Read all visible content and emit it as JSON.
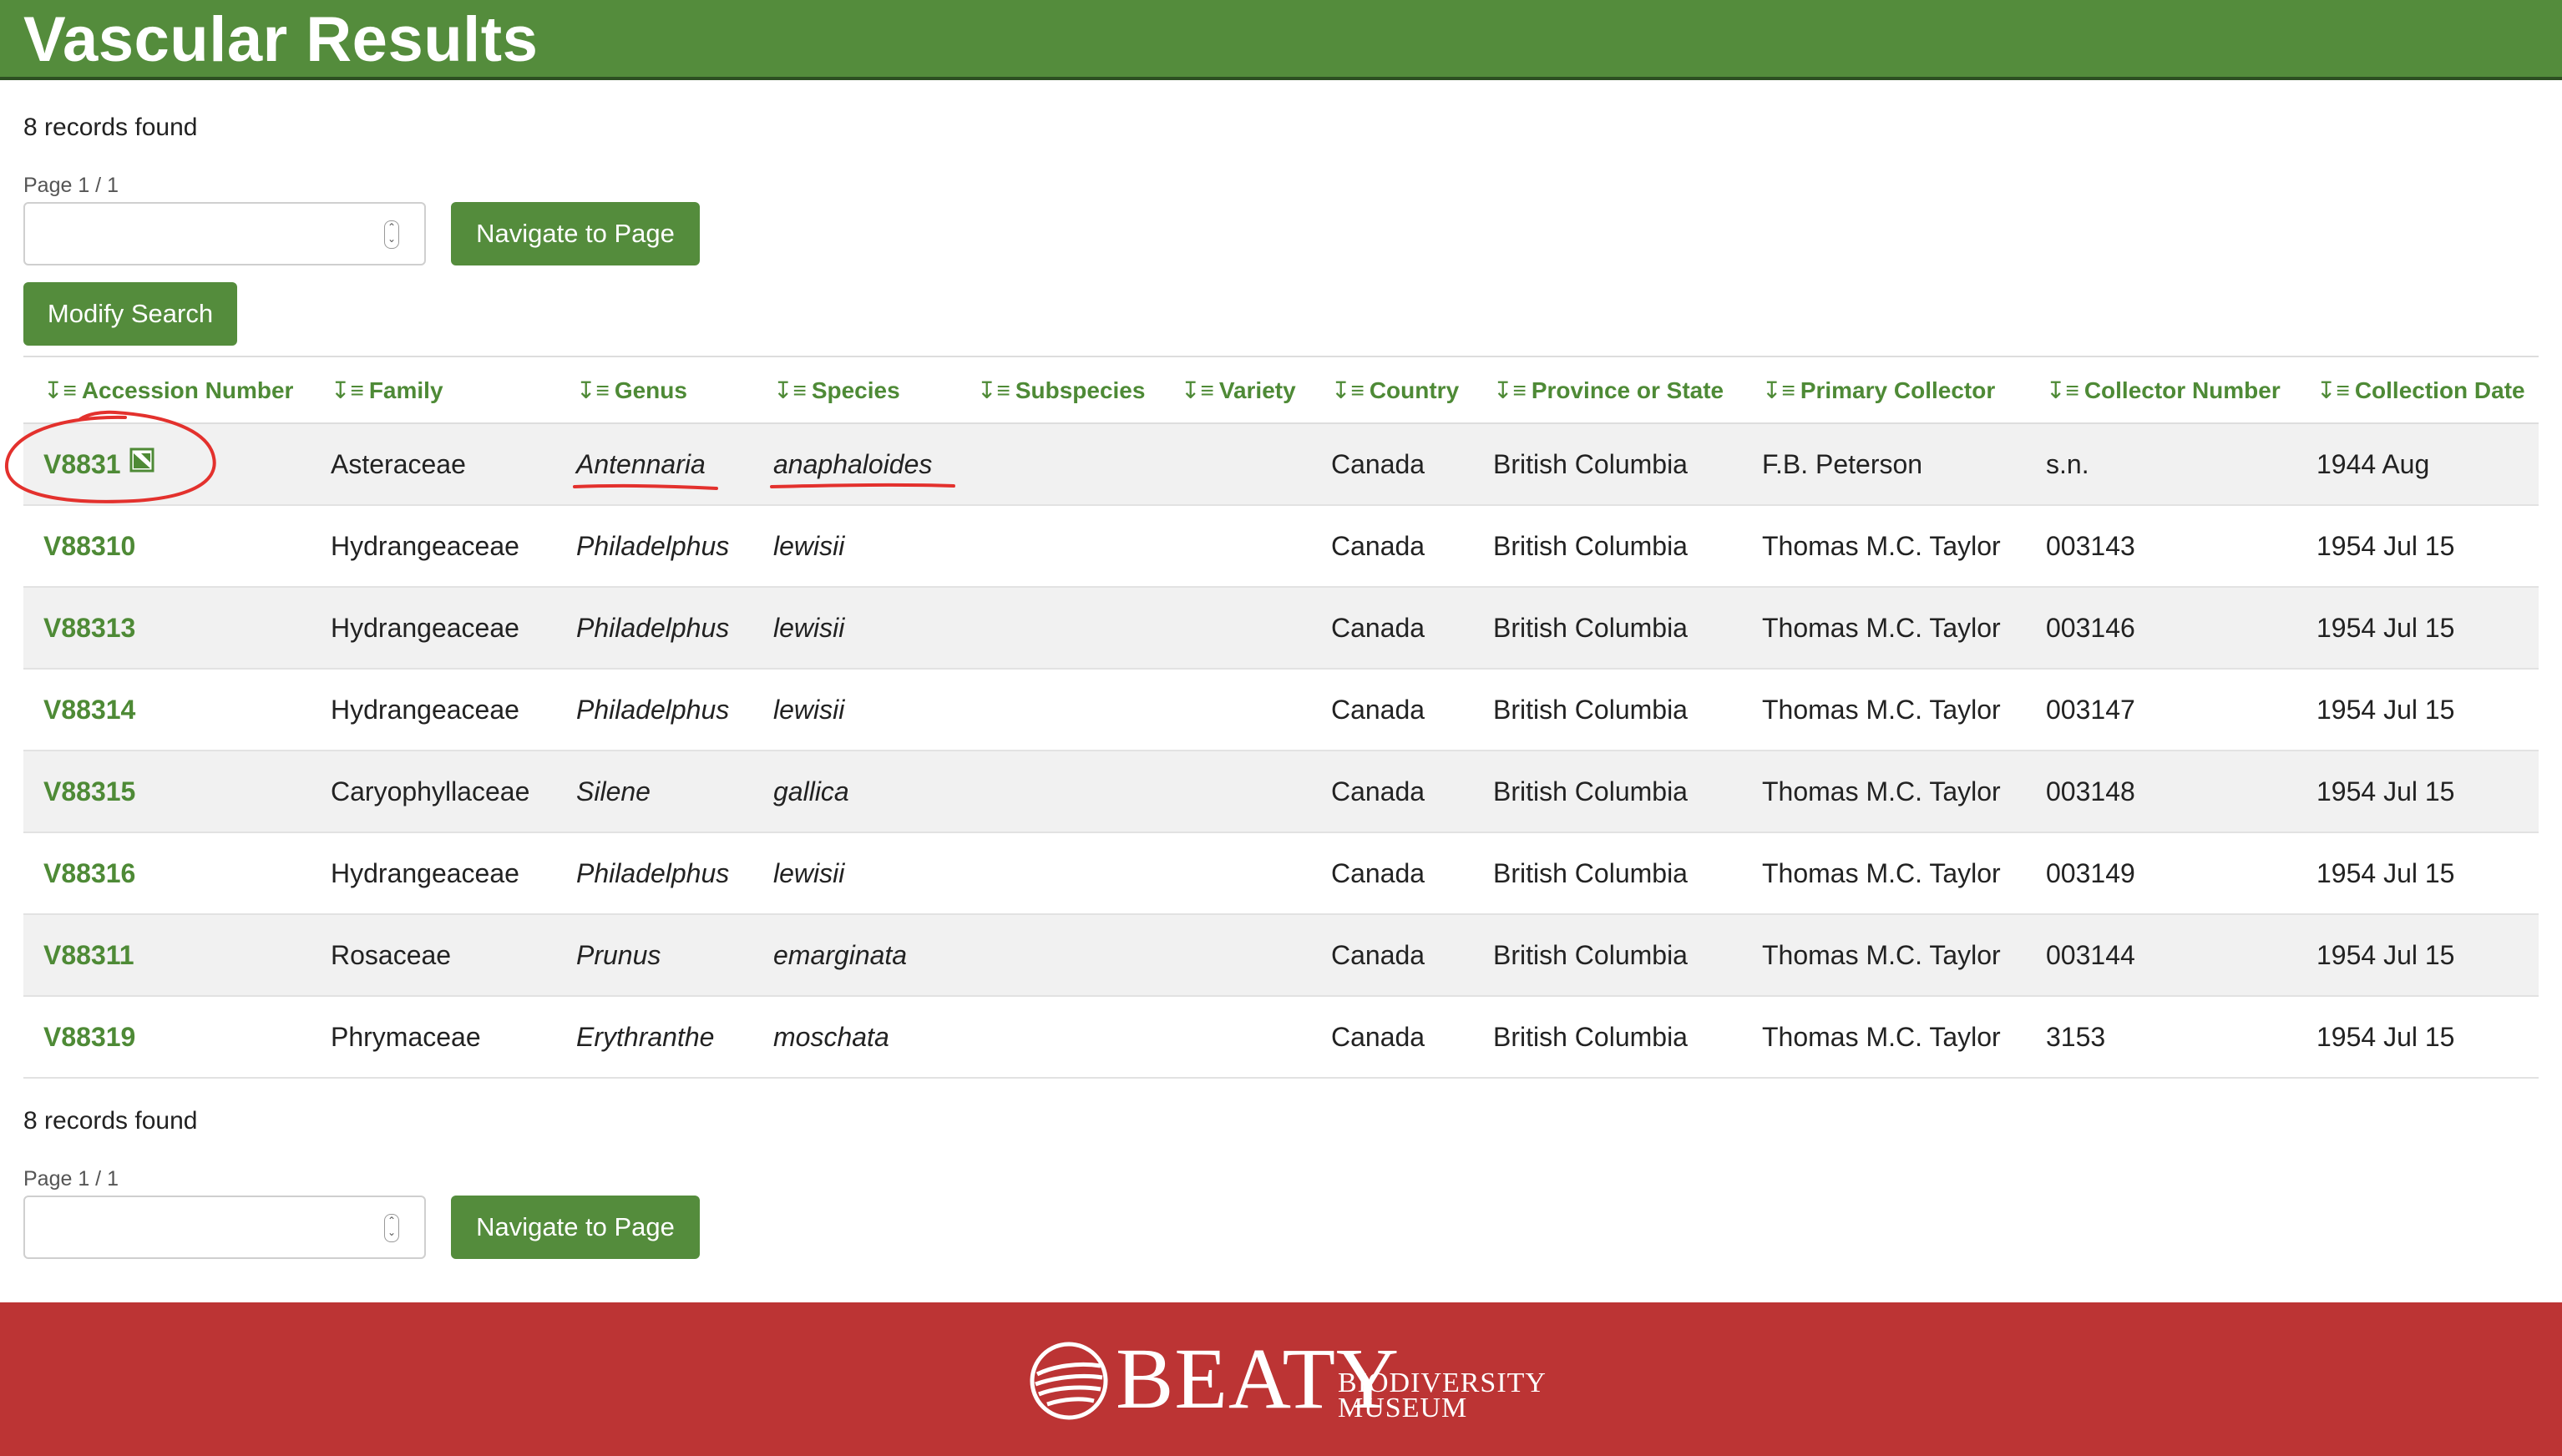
{
  "header": {
    "title": "Vascular Results"
  },
  "pagination_top": {
    "records_found": "8 records found",
    "page_label": "Page 1 / 1",
    "page_input_value": "",
    "navigate_label": "Navigate to Page"
  },
  "modify_search_label": "Modify Search",
  "table": {
    "columns": [
      "Accession Number",
      "Family",
      "Genus",
      "Species",
      "Subspecies",
      "Variety",
      "Country",
      "Province or State",
      "Primary Collector",
      "Collector Number",
      "Collection Date"
    ],
    "rows": [
      {
        "accession": "V8831",
        "has_image": true,
        "family": "Asteraceae",
        "genus": "Antennaria",
        "species": "anaphaloides",
        "subspecies": "",
        "variety": "",
        "country": "Canada",
        "province": "British Columbia",
        "collector": "F.B. Peterson",
        "collector_number": "s.n.",
        "date": "1944 Aug"
      },
      {
        "accession": "V88310",
        "has_image": false,
        "family": "Hydrangeaceae",
        "genus": "Philadelphus",
        "species": "lewisii",
        "subspecies": "",
        "variety": "",
        "country": "Canada",
        "province": "British Columbia",
        "collector": "Thomas M.C. Taylor",
        "collector_number": "003143",
        "date": "1954 Jul 15"
      },
      {
        "accession": "V88313",
        "has_image": false,
        "family": "Hydrangeaceae",
        "genus": "Philadelphus",
        "species": "lewisii",
        "subspecies": "",
        "variety": "",
        "country": "Canada",
        "province": "British Columbia",
        "collector": "Thomas M.C. Taylor",
        "collector_number": "003146",
        "date": "1954 Jul 15"
      },
      {
        "accession": "V88314",
        "has_image": false,
        "family": "Hydrangeaceae",
        "genus": "Philadelphus",
        "species": "lewisii",
        "subspecies": "",
        "variety": "",
        "country": "Canada",
        "province": "British Columbia",
        "collector": "Thomas M.C. Taylor",
        "collector_number": "003147",
        "date": "1954 Jul 15"
      },
      {
        "accession": "V88315",
        "has_image": false,
        "family": "Caryophyllaceae",
        "genus": "Silene",
        "species": "gallica",
        "subspecies": "",
        "variety": "",
        "country": "Canada",
        "province": "British Columbia",
        "collector": "Thomas M.C. Taylor",
        "collector_number": "003148",
        "date": "1954 Jul 15"
      },
      {
        "accession": "V88316",
        "has_image": false,
        "family": "Hydrangeaceae",
        "genus": "Philadelphus",
        "species": "lewisii",
        "subspecies": "",
        "variety": "",
        "country": "Canada",
        "province": "British Columbia",
        "collector": "Thomas M.C. Taylor",
        "collector_number": "003149",
        "date": "1954 Jul 15"
      },
      {
        "accession": "V88311",
        "has_image": false,
        "family": "Rosaceae",
        "genus": "Prunus",
        "species": "emarginata",
        "subspecies": "",
        "variety": "",
        "country": "Canada",
        "province": "British Columbia",
        "collector": "Thomas M.C. Taylor",
        "collector_number": "003144",
        "date": "1954 Jul 15"
      },
      {
        "accession": "V88319",
        "has_image": false,
        "family": "Phrymaceae",
        "genus": "Erythranthe",
        "species": "moschata",
        "subspecies": "",
        "variety": "",
        "country": "Canada",
        "province": "British Columbia",
        "collector": "Thomas M.C. Taylor",
        "collector_number": "3153",
        "date": "1954 Jul 15"
      }
    ]
  },
  "pagination_bottom": {
    "records_found": "8 records found",
    "page_label": "Page 1 / 1",
    "page_input_value": "",
    "navigate_label": "Navigate to Page"
  },
  "footer": {
    "logo_word": "BEATY",
    "logo_sub_line1": "BIODIVERSITY",
    "logo_sub_line2": "MUSEUM"
  },
  "icons": {
    "sort": "sort-icon",
    "image": "image-icon",
    "spinner": "number-spinner-icon"
  },
  "colors": {
    "header_bg": "#548c3c",
    "accent_green": "#4e8a36",
    "footer_bg": "#bc3434",
    "annotation_red": "#e3312d",
    "row_stripe": "#f1f1f1"
  }
}
